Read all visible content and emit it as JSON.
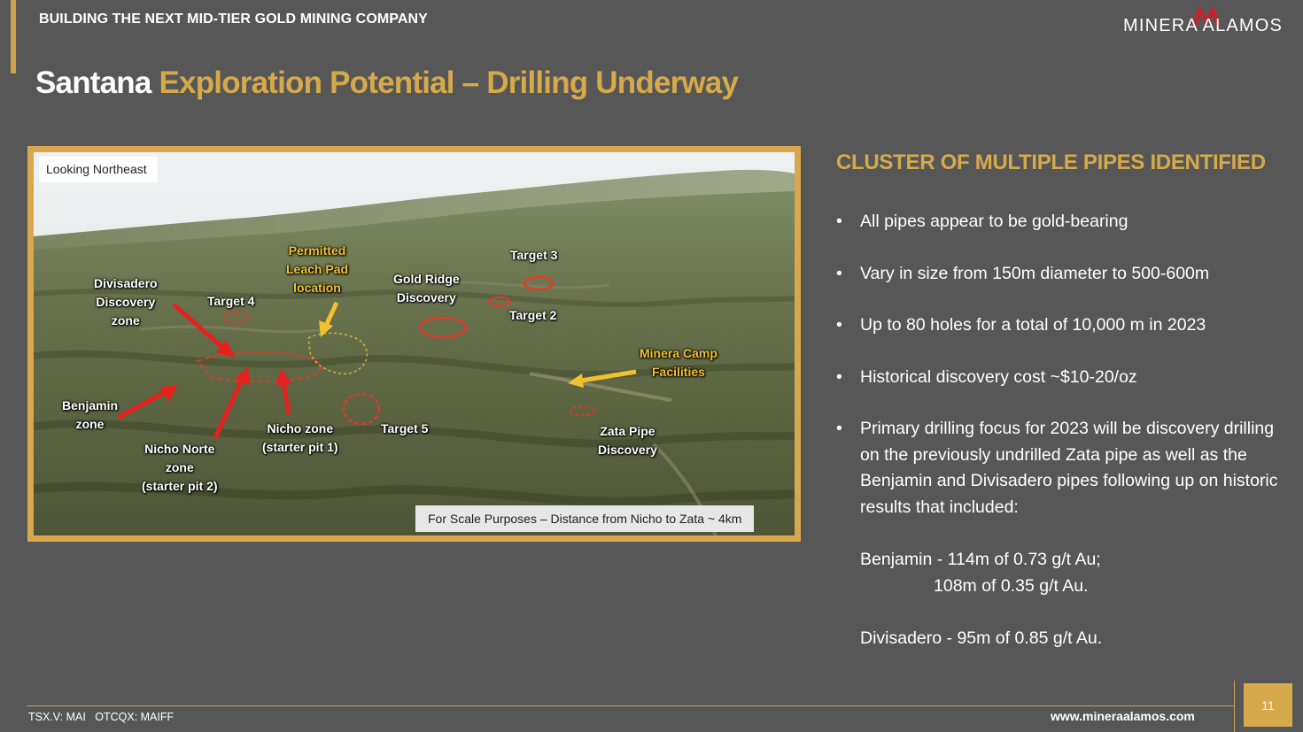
{
  "header": {
    "tagline": "BUILDING THE NEXT MID-TIER GOLD MINING COMPANY",
    "logo_text": "MINERA ALAMOS"
  },
  "title": {
    "part1": "Santana",
    "part2": " Exploration Potential – Drilling Underway"
  },
  "map": {
    "caption": "Looking Northeast",
    "scale_note": "For Scale Purposes – Distance from Nicho to Zata ~ 4km",
    "labels": {
      "permitted": [
        "Permitted",
        "Leach Pad",
        "location"
      ],
      "divisadero": [
        "Divisadero",
        "Discovery",
        "zone"
      ],
      "target4": "Target 4",
      "gold_ridge": [
        "Gold Ridge",
        "Discovery"
      ],
      "target3": "Target 3",
      "target2": "Target 2",
      "minera_camp": [
        "Minera Camp",
        "Facilities"
      ],
      "benjamin": [
        "Benjamin",
        "zone"
      ],
      "nicho_norte": [
        "Nicho Norte",
        "zone",
        "(starter pit 2)"
      ],
      "nicho_zone": [
        "Nicho zone",
        "(starter pit 1)"
      ],
      "target5": "Target 5",
      "zata": [
        "Zata Pipe",
        "Discovery"
      ]
    }
  },
  "sidebar": {
    "heading": "CLUSTER OF MULTIPLE PIPES IDENTIFIED",
    "bullet_char": "•",
    "bullets": [
      "All pipes appear to be gold-bearing",
      "Vary in size from 150m diameter to 500-600m",
      "Up to 80 holes for a total of 10,000 m in 2023",
      "Historical discovery cost ~$10-20/oz",
      "Primary drilling focus for 2023 will be discovery drilling on the previously undrilled Zata pipe as well as the Benjamin and Divisadero pipes following up on historic results that included:"
    ],
    "results": {
      "benjamin_line1": "Benjamin - 114m of 0.73 g/t Au;",
      "benjamin_line2": "108m of 0.35 g/t Au.",
      "divisadero": "Divisadero - 95m of 0.85 g/t Au."
    }
  },
  "footer": {
    "ticker": "TSX.V: MAI   OTCQX: MAIFF",
    "website": "www.mineraalamos.com",
    "page_number": "11"
  },
  "colors": {
    "accent": "#d6a94a",
    "background": "#575757",
    "logo_red": "#c8202a"
  }
}
